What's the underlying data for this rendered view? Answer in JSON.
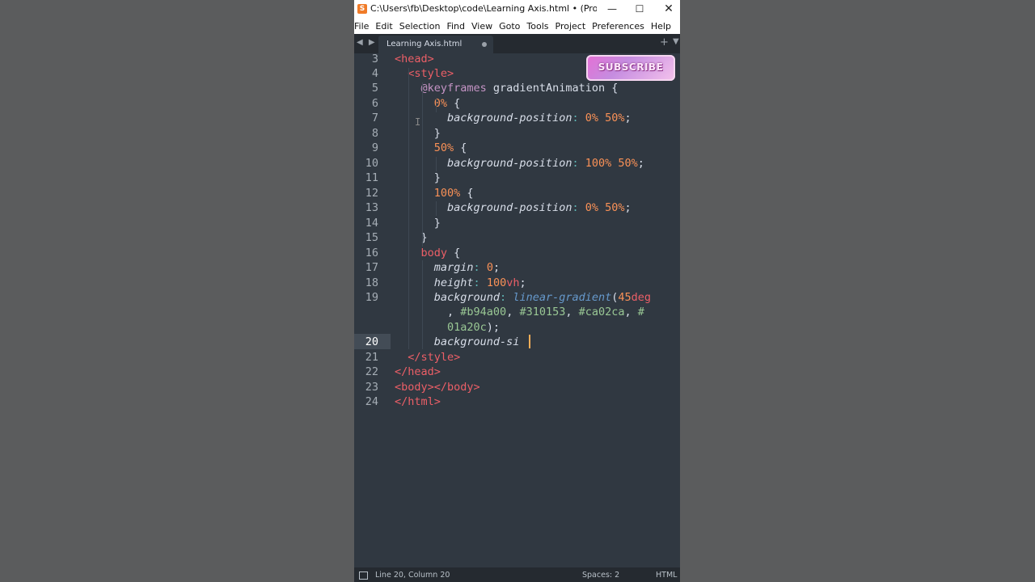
{
  "window": {
    "title": "C:\\Users\\fb\\Desktop\\code\\Learning Axis.html • (Project) - Su...",
    "app_icon": "S",
    "min_glyph": "—",
    "max_glyph": "☐",
    "close_glyph": "✕"
  },
  "menu": [
    "File",
    "Edit",
    "Selection",
    "Find",
    "View",
    "Goto",
    "Tools",
    "Project",
    "Preferences",
    "Help"
  ],
  "tabbar": {
    "nav_glyph": "◀ ▶",
    "tab_label": "Learning Axis.html",
    "plus_glyph": "+",
    "down_glyph": "▼"
  },
  "overlay": {
    "subscribe_label": "SUBSCRIBE"
  },
  "editor": {
    "active_line": "20",
    "ibeam_glyph": "I",
    "lines": [
      {
        "num": "3",
        "segs": [
          [
            "tag",
            "<head>"
          ]
        ]
      },
      {
        "num": "4",
        "segs": [
          [
            "tag",
            "  <style>"
          ]
        ]
      },
      {
        "num": "5",
        "segs": [
          [
            "at",
            "    @keyframes"
          ],
          [
            "plain",
            " gradientAnimation {"
          ]
        ]
      },
      {
        "num": "6",
        "segs": [
          [
            "num",
            "      0%"
          ],
          [
            "plain",
            " {"
          ]
        ]
      },
      {
        "num": "7",
        "segs": [
          [
            "prop",
            "        background-position"
          ],
          [
            "pun",
            ":"
          ],
          [
            "num",
            " 0%"
          ],
          [
            "num",
            " 50%"
          ],
          [
            "plain",
            ";"
          ]
        ]
      },
      {
        "num": "8",
        "segs": [
          [
            "plain",
            "      }"
          ]
        ]
      },
      {
        "num": "9",
        "segs": [
          [
            "num",
            "      50%"
          ],
          [
            "plain",
            " {"
          ]
        ]
      },
      {
        "num": "10",
        "segs": [
          [
            "prop",
            "        background-position"
          ],
          [
            "pun",
            ":"
          ],
          [
            "num",
            " 100%"
          ],
          [
            "num",
            " 50%"
          ],
          [
            "plain",
            ";"
          ]
        ]
      },
      {
        "num": "11",
        "segs": [
          [
            "plain",
            "      }"
          ]
        ]
      },
      {
        "num": "12",
        "segs": [
          [
            "num",
            "      100%"
          ],
          [
            "plain",
            " {"
          ]
        ]
      },
      {
        "num": "13",
        "segs": [
          [
            "prop",
            "        background-position"
          ],
          [
            "pun",
            ":"
          ],
          [
            "num",
            " 0%"
          ],
          [
            "num",
            " 50%"
          ],
          [
            "plain",
            ";"
          ]
        ]
      },
      {
        "num": "14",
        "segs": [
          [
            "plain",
            "      }"
          ]
        ]
      },
      {
        "num": "15",
        "segs": [
          [
            "plain",
            "    }"
          ]
        ]
      },
      {
        "num": "16",
        "segs": [
          [
            "tag",
            "    body"
          ],
          [
            "plain",
            " {"
          ]
        ]
      },
      {
        "num": "17",
        "segs": [
          [
            "prop",
            "      margin"
          ],
          [
            "pun",
            ":"
          ],
          [
            "num",
            " 0"
          ],
          [
            "plain",
            ";"
          ]
        ]
      },
      {
        "num": "18",
        "segs": [
          [
            "prop",
            "      height"
          ],
          [
            "pun",
            ":"
          ],
          [
            "num",
            " 100"
          ],
          [
            "tag",
            "vh"
          ],
          [
            "plain",
            ";"
          ]
        ]
      },
      {
        "num": "19",
        "segs": [
          [
            "prop",
            "      background"
          ],
          [
            "pun",
            ":"
          ],
          [
            "fn",
            " linear-gradient"
          ],
          [
            "plain",
            "("
          ],
          [
            "num",
            "45"
          ],
          [
            "tag",
            "deg"
          ]
        ]
      },
      {
        "num": "",
        "segs": [
          [
            "plain",
            "        , "
          ],
          [
            "hex",
            "#b94a00"
          ],
          [
            "plain",
            ", "
          ],
          [
            "hex",
            "#310153"
          ],
          [
            "plain",
            ", "
          ],
          [
            "hex",
            "#ca02ca"
          ],
          [
            "plain",
            ", "
          ],
          [
            "hex",
            "#"
          ]
        ]
      },
      {
        "num": "",
        "segs": [
          [
            "hex",
            "        01a20c"
          ],
          [
            "plain",
            ");"
          ]
        ]
      },
      {
        "num": "20",
        "segs": [
          [
            "prop",
            "      background-si"
          ]
        ]
      },
      {
        "num": "21",
        "segs": [
          [
            "tag",
            "  </style>"
          ]
        ]
      },
      {
        "num": "22",
        "segs": [
          [
            "tag",
            "</head>"
          ]
        ]
      },
      {
        "num": "23",
        "segs": [
          [
            "tag",
            "<body></body>"
          ]
        ]
      },
      {
        "num": "24",
        "segs": [
          [
            "tag",
            "</html>"
          ]
        ]
      }
    ]
  },
  "status": {
    "position": "Line 20, Column 20",
    "spaces": "Spaces: 2",
    "syntax": "HTML"
  }
}
